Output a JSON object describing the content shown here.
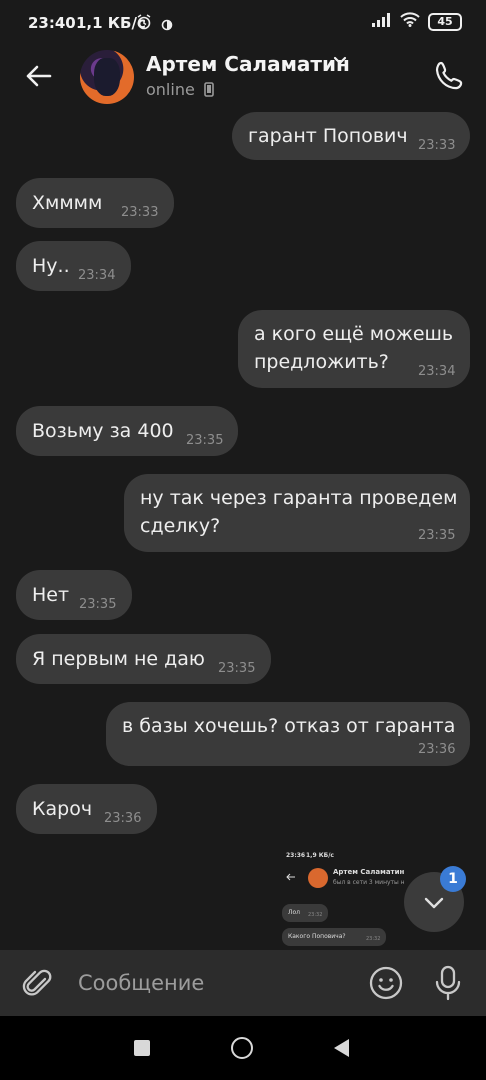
{
  "status_bar": {
    "time": "23:40",
    "speed": "1,1 КБ/с",
    "battery": "45"
  },
  "header": {
    "contact_name": "Артем Саламатин",
    "status": "online"
  },
  "messages": [
    {
      "text": "гарант Попович",
      "time": "23:33",
      "outgoing": true
    },
    {
      "text": "Хмммм",
      "time": "23:33",
      "outgoing": false
    },
    {
      "text": "Ну..",
      "time": "23:34",
      "outgoing": false
    },
    {
      "text_line1": "а кого ещё можешь",
      "text_line2": "предложить?",
      "time": "23:34",
      "outgoing": true
    },
    {
      "text": "Возьму за 400",
      "time": "23:35",
      "outgoing": false
    },
    {
      "text_line1": "ну так через гаранта проведем",
      "text_line2": "сделку?",
      "time": "23:35",
      "outgoing": true
    },
    {
      "text": "Нет",
      "time": "23:35",
      "outgoing": false
    },
    {
      "text": "Я первым не даю",
      "time": "23:35",
      "outgoing": false
    },
    {
      "text": "в базы хочешь? отказ от гаранта",
      "time": "23:36",
      "outgoing": true
    },
    {
      "text": "Кароч",
      "time": "23:36",
      "outgoing": false
    }
  ],
  "screenshot_preview": {
    "time": "23:36",
    "speed": "1,9 КБ/с",
    "name": "Артем Саламатин",
    "status": "был в сети 3 минуты н",
    "msg1": "Лол",
    "msg1_time": "23:32",
    "msg2": "Какого Поповича?",
    "msg2_time": "23:32"
  },
  "scroll_down": {
    "badge": "1"
  },
  "composer": {
    "placeholder": "Сообщение"
  },
  "colors": {
    "background": "#1a1a1a",
    "bubble": "#3a3a3a",
    "badge": "#3a7bd5"
  }
}
